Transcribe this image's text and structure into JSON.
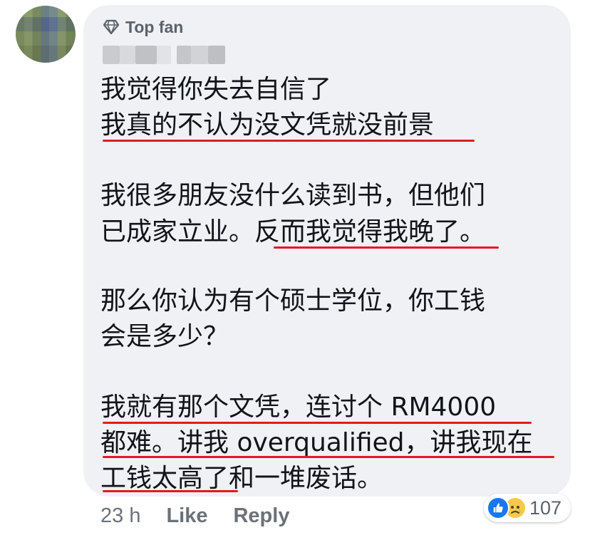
{
  "comment": {
    "badge_label": "Top fan",
    "lines": [
      "我觉得你失去自信了",
      "我真的不认为没文凭就没前景",
      "",
      "我很多朋友没什么读到书，但他们",
      "已成家立业。反而我觉得我晚了。",
      "",
      "那么你认为有个硕士学位，你工钱",
      "会是多少？",
      "",
      "我就有那个文凭，连讨个 RM4000",
      "都难。讲我 overqualified，讲我现在",
      "工钱太高了和一堆废话。"
    ]
  },
  "footer": {
    "time": "23 h",
    "like_label": "Like",
    "reply_label": "Reply"
  },
  "reactions": {
    "count": "107",
    "icons": [
      "like-icon",
      "sad-icon"
    ]
  },
  "colors": {
    "bubble": "#eff1f4",
    "underline": "#e01b22",
    "like_blue": "#1877f2",
    "muted": "#6b717a"
  }
}
